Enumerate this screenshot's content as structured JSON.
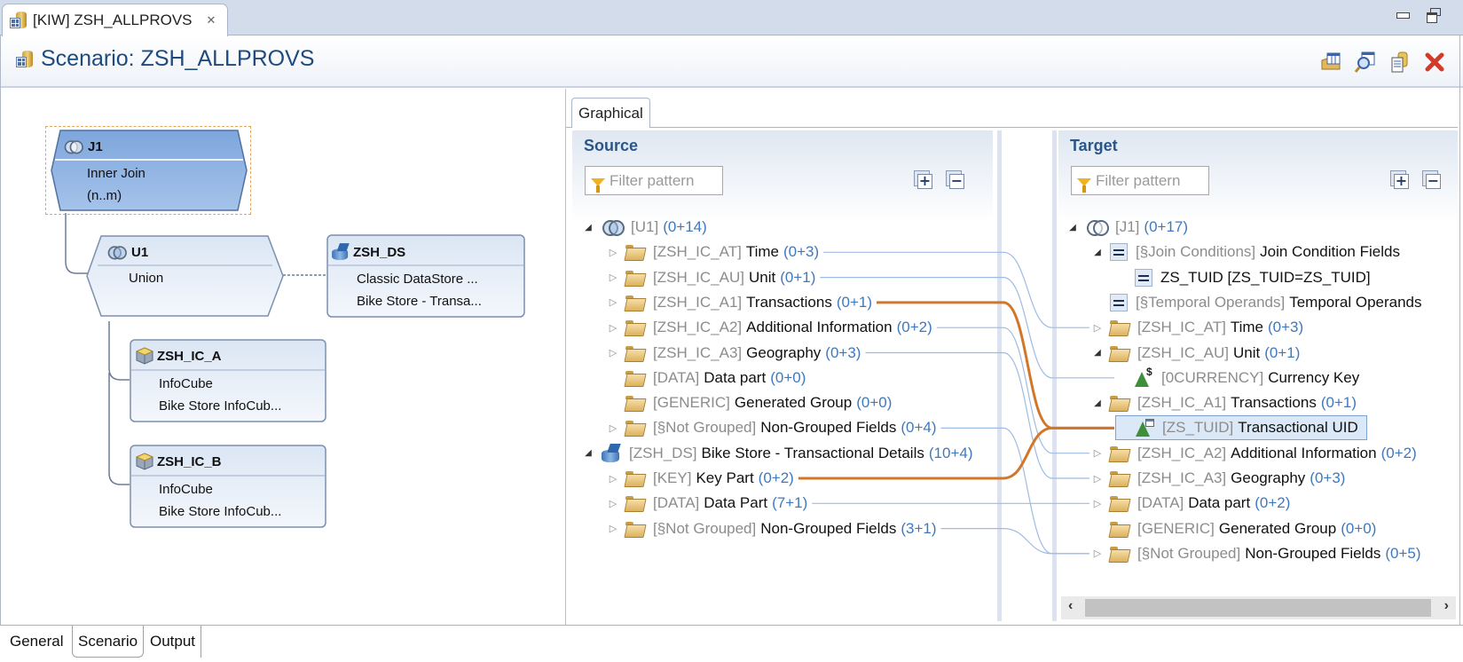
{
  "window": {
    "editor_tab_label": "[KIW] ZSH_ALLPROVS",
    "editor_tab_icon": "scenario-icon",
    "controls": [
      "minimize",
      "restore"
    ]
  },
  "header": {
    "title": "Scenario: ZSH_ALLPROVS",
    "actions": [
      {
        "name": "display-table-button",
        "icon": "table-folder-icon"
      },
      {
        "name": "search-button",
        "icon": "magnifier-icon"
      },
      {
        "name": "copy-button",
        "icon": "copy-document-icon"
      },
      {
        "name": "delete-button",
        "icon": "red-x-icon",
        "color": "#d23b2b"
      }
    ]
  },
  "diagram": {
    "nodes": [
      {
        "id": "J1",
        "title": "J1",
        "line1": "Inner Join",
        "line2": "(n..m)",
        "icon": "join-icon",
        "selected": true,
        "shape": "hexagon"
      },
      {
        "id": "U1",
        "title": "U1",
        "line1": "Union",
        "line2": "",
        "icon": "union-icon",
        "selected": false,
        "shape": "hexagon"
      },
      {
        "id": "ZSH_DS",
        "title": "ZSH_DS",
        "line1": "Classic DataStore ...",
        "line2": "Bike Store - Transa...",
        "icon": "datastore-icon"
      },
      {
        "id": "ZSH_IC_A",
        "title": "ZSH_IC_A",
        "line1": "InfoCube",
        "line2": "Bike Store InfoCub...",
        "icon": "infocube-icon"
      },
      {
        "id": "ZSH_IC_B",
        "title": "ZSH_IC_B",
        "line1": "InfoCube",
        "line2": "Bike Store InfoCub...",
        "icon": "infocube-icon"
      }
    ]
  },
  "mapping": {
    "tab_label": "Graphical",
    "source": {
      "title": "Source",
      "filter_placeholder": "Filter pattern",
      "rows": [
        {
          "level": 0,
          "expander": "open",
          "icon": "union",
          "key": "[U1]",
          "label": "",
          "count": "(0+14)"
        },
        {
          "level": 1,
          "expander": "closed",
          "icon": "folder",
          "key": "[ZSH_IC_AT]",
          "label": "Time",
          "count": "(0+3)"
        },
        {
          "level": 1,
          "expander": "closed",
          "icon": "folder",
          "key": "[ZSH_IC_AU]",
          "label": "Unit",
          "count": "(0+1)"
        },
        {
          "level": 1,
          "expander": "closed",
          "icon": "folder",
          "key": "[ZSH_IC_A1]",
          "label": "Transactions",
          "count": "(0+1)"
        },
        {
          "level": 1,
          "expander": "closed",
          "icon": "folder",
          "key": "[ZSH_IC_A2]",
          "label": "Additional Information",
          "count": "(0+2)"
        },
        {
          "level": 1,
          "expander": "closed",
          "icon": "folder",
          "key": "[ZSH_IC_A3]",
          "label": "Geography",
          "count": "(0+3)"
        },
        {
          "level": 1,
          "expander": "none",
          "icon": "folder",
          "key": "[DATA]",
          "label": "Data part",
          "count": "(0+0)"
        },
        {
          "level": 1,
          "expander": "none",
          "icon": "folder",
          "key": "[GENERIC]",
          "label": "Generated Group",
          "count": "(0+0)"
        },
        {
          "level": 1,
          "expander": "closed",
          "icon": "folder",
          "key": "[§Not Grouped]",
          "label": "Non-Grouped Fields",
          "count": "(0+4)"
        },
        {
          "level": 0,
          "expander": "open",
          "icon": "datastore",
          "key": "[ZSH_DS]",
          "label": "Bike Store - Transactional Details",
          "count": "(10+4)"
        },
        {
          "level": 1,
          "expander": "closed",
          "icon": "folder",
          "key": "[KEY]",
          "label": "Key Part",
          "count": "(0+2)"
        },
        {
          "level": 1,
          "expander": "closed",
          "icon": "folder",
          "key": "[DATA]",
          "label": "Data Part",
          "count": "(7+1)"
        },
        {
          "level": 1,
          "expander": "closed",
          "icon": "folder",
          "key": "[§Not Grouped]",
          "label": "Non-Grouped Fields",
          "count": "(3+1)"
        }
      ]
    },
    "target": {
      "title": "Target",
      "filter_placeholder": "Filter pattern",
      "rows": [
        {
          "level": 0,
          "expander": "open",
          "icon": "join",
          "key": "[J1]",
          "label": "",
          "count": "(0+17)"
        },
        {
          "level": 1,
          "expander": "open",
          "icon": "equals",
          "key": "[§Join Conditions]",
          "label": "Join Condition Fields",
          "count": ""
        },
        {
          "level": 2,
          "expander": "none",
          "icon": "equals",
          "key": "",
          "label": "ZS_TUID [ZS_TUID=ZS_TUID]",
          "count": ""
        },
        {
          "level": 1,
          "expander": "none",
          "icon": "equals",
          "key": "[§Temporal Operands]",
          "label": "Temporal Operands",
          "count": ""
        },
        {
          "level": 1,
          "expander": "closed",
          "icon": "folder",
          "key": "[ZSH_IC_AT]",
          "label": "Time",
          "count": "(0+3)"
        },
        {
          "level": 1,
          "expander": "open",
          "icon": "folder",
          "key": "[ZSH_IC_AU]",
          "label": "Unit",
          "count": "(0+1)"
        },
        {
          "level": 2,
          "expander": "none",
          "icon": "unit-characteristic",
          "key": "[0CURRENCY]",
          "label": "Currency Key",
          "count": ""
        },
        {
          "level": 1,
          "expander": "open",
          "icon": "folder",
          "key": "[ZSH_IC_A1]",
          "label": "Transactions",
          "count": "(0+1)"
        },
        {
          "level": 2,
          "expander": "none",
          "icon": "characteristic",
          "key": "[ZS_TUID]",
          "label": "Transactional UID",
          "count": "",
          "selected": true
        },
        {
          "level": 1,
          "expander": "closed",
          "icon": "folder",
          "key": "[ZSH_IC_A2]",
          "label": "Additional Information",
          "count": "(0+2)"
        },
        {
          "level": 1,
          "expander": "closed",
          "icon": "folder",
          "key": "[ZSH_IC_A3]",
          "label": "Geography",
          "count": "(0+3)"
        },
        {
          "level": 1,
          "expander": "closed",
          "icon": "folder",
          "key": "[DATA]",
          "label": "Data part",
          "count": "(0+2)"
        },
        {
          "level": 1,
          "expander": "none",
          "icon": "folder",
          "key": "[GENERIC]",
          "label": "Generated Group",
          "count": "(0+0)"
        },
        {
          "level": 1,
          "expander": "closed",
          "icon": "folder",
          "key": "[§Not Grouped]",
          "label": "Non-Grouped Fields",
          "count": "(0+5)"
        }
      ]
    },
    "connections": [
      {
        "from": 1,
        "to": 4,
        "highlight": false
      },
      {
        "from": 2,
        "to": 6,
        "highlight": false
      },
      {
        "from": 3,
        "to": 8,
        "highlight": true
      },
      {
        "from": 4,
        "to": 9,
        "highlight": false
      },
      {
        "from": 5,
        "to": 10,
        "highlight": false
      },
      {
        "from": 8,
        "to": 13,
        "highlight": false
      },
      {
        "from": 10,
        "to": 8,
        "highlight": true
      },
      {
        "from": 11,
        "to": 11,
        "highlight": false
      },
      {
        "from": 12,
        "to": 13,
        "highlight": false
      }
    ],
    "colors": {
      "highlight": "#d2772a",
      "normal": "#9ebbe3"
    }
  },
  "bottom_tabs": [
    {
      "label": "General",
      "active": false
    },
    {
      "label": "Scenario",
      "active": true
    },
    {
      "label": "Output",
      "active": false
    }
  ]
}
